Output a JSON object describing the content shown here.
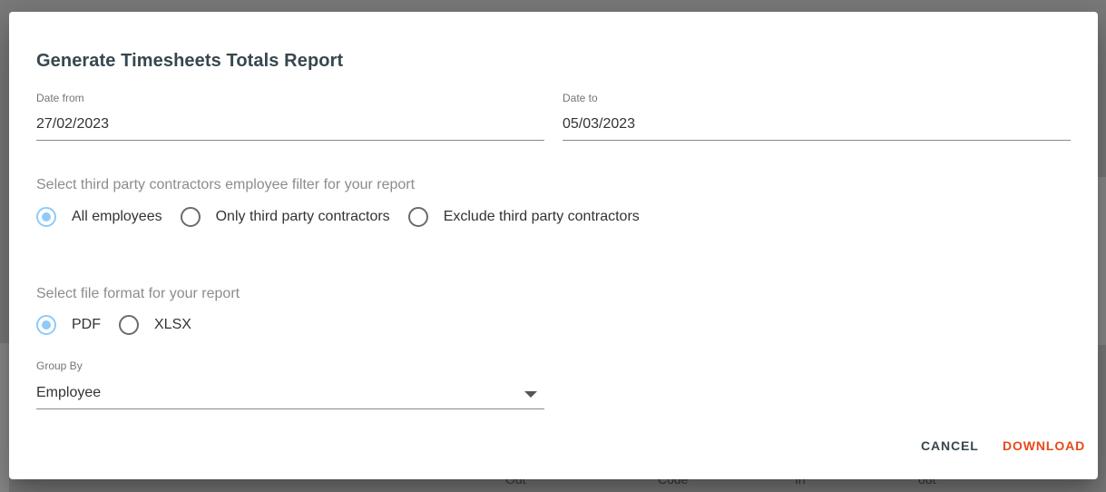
{
  "dialog": {
    "title": "Generate Timesheets Totals Report",
    "date_from": {
      "label": "Date from",
      "value": "27/02/2023"
    },
    "date_to": {
      "label": "Date to",
      "value": "05/03/2023"
    },
    "contractor_filter": {
      "prompt": "Select third party contractors employee filter for your report",
      "options": [
        {
          "label": "All employees",
          "selected": true
        },
        {
          "label": "Only third party contractors",
          "selected": false
        },
        {
          "label": "Exclude third party contractors",
          "selected": false
        }
      ]
    },
    "file_format": {
      "prompt": "Select file format for your report",
      "options": [
        {
          "label": "PDF",
          "selected": true
        },
        {
          "label": "XLSX",
          "selected": false
        }
      ]
    },
    "group_by": {
      "label": "Group By",
      "value": "Employee"
    },
    "buttons": {
      "cancel": "CANCEL",
      "download": "DOWNLOAD"
    }
  },
  "background": {
    "column_fragments": [
      "Out",
      "Code",
      "In",
      "out"
    ]
  },
  "colors": {
    "title": "#37474f",
    "radio_selected": "#90caf9",
    "download_accent": "#e64a19",
    "overlay": "#7a7a7a"
  }
}
